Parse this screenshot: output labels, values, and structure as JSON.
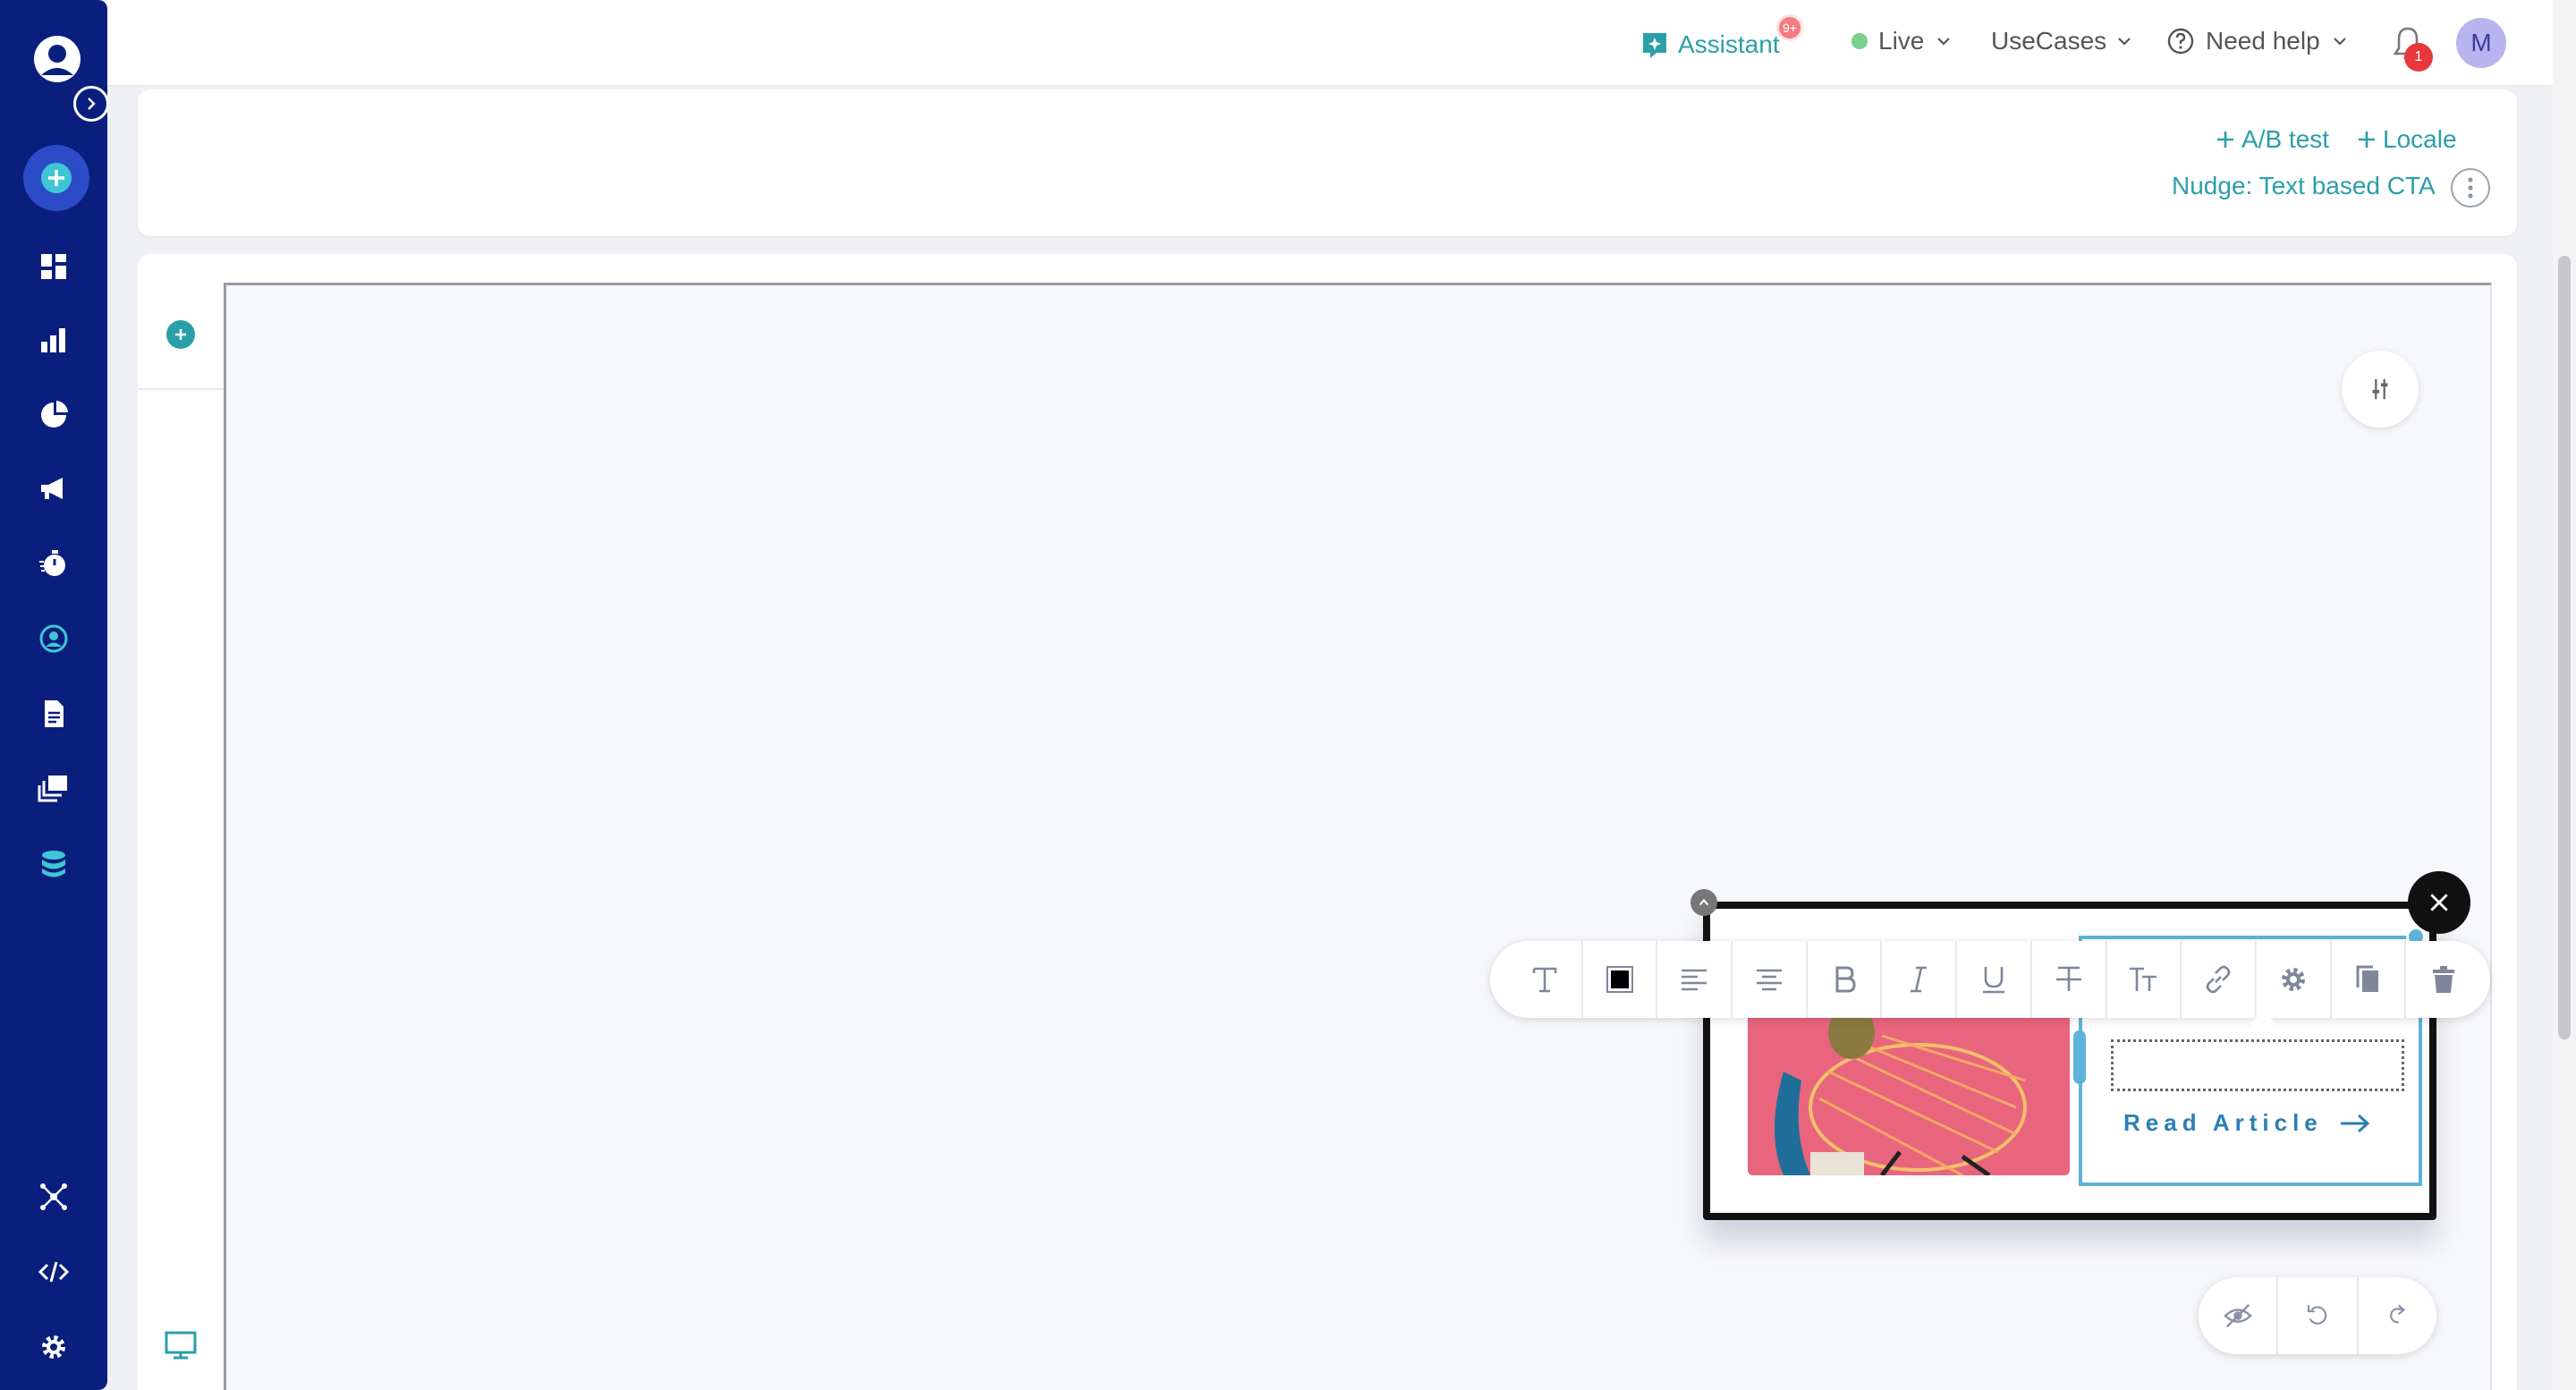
{
  "topbar": {
    "assistant_label": "Assistant",
    "assistant_badge": "9+",
    "env_label": "Live",
    "usecases_label": "UseCases",
    "help_label": "Need help",
    "notification_count": "1",
    "avatar_initial": "M"
  },
  "header": {
    "ab_test_label": "A/B test",
    "locale_label": "Locale",
    "nudge_name": "Nudge: Text based CTA"
  },
  "nudge": {
    "cta_label": "Read Article"
  },
  "colors": {
    "sidebar_bg": "#0a1f7d",
    "accent_teal": "#2a9fa8",
    "selection_blue": "#5fb2dc",
    "image_pink": "#e8657d"
  },
  "sidebar": {
    "items": [
      "dashboard-icon",
      "bar-chart-icon",
      "pie-chart-icon",
      "megaphone-icon",
      "stopwatch-icon",
      "user-target-icon",
      "document-icon",
      "gallery-icon",
      "database-icon",
      "network-icon",
      "code-icon",
      "settings-icon"
    ]
  }
}
